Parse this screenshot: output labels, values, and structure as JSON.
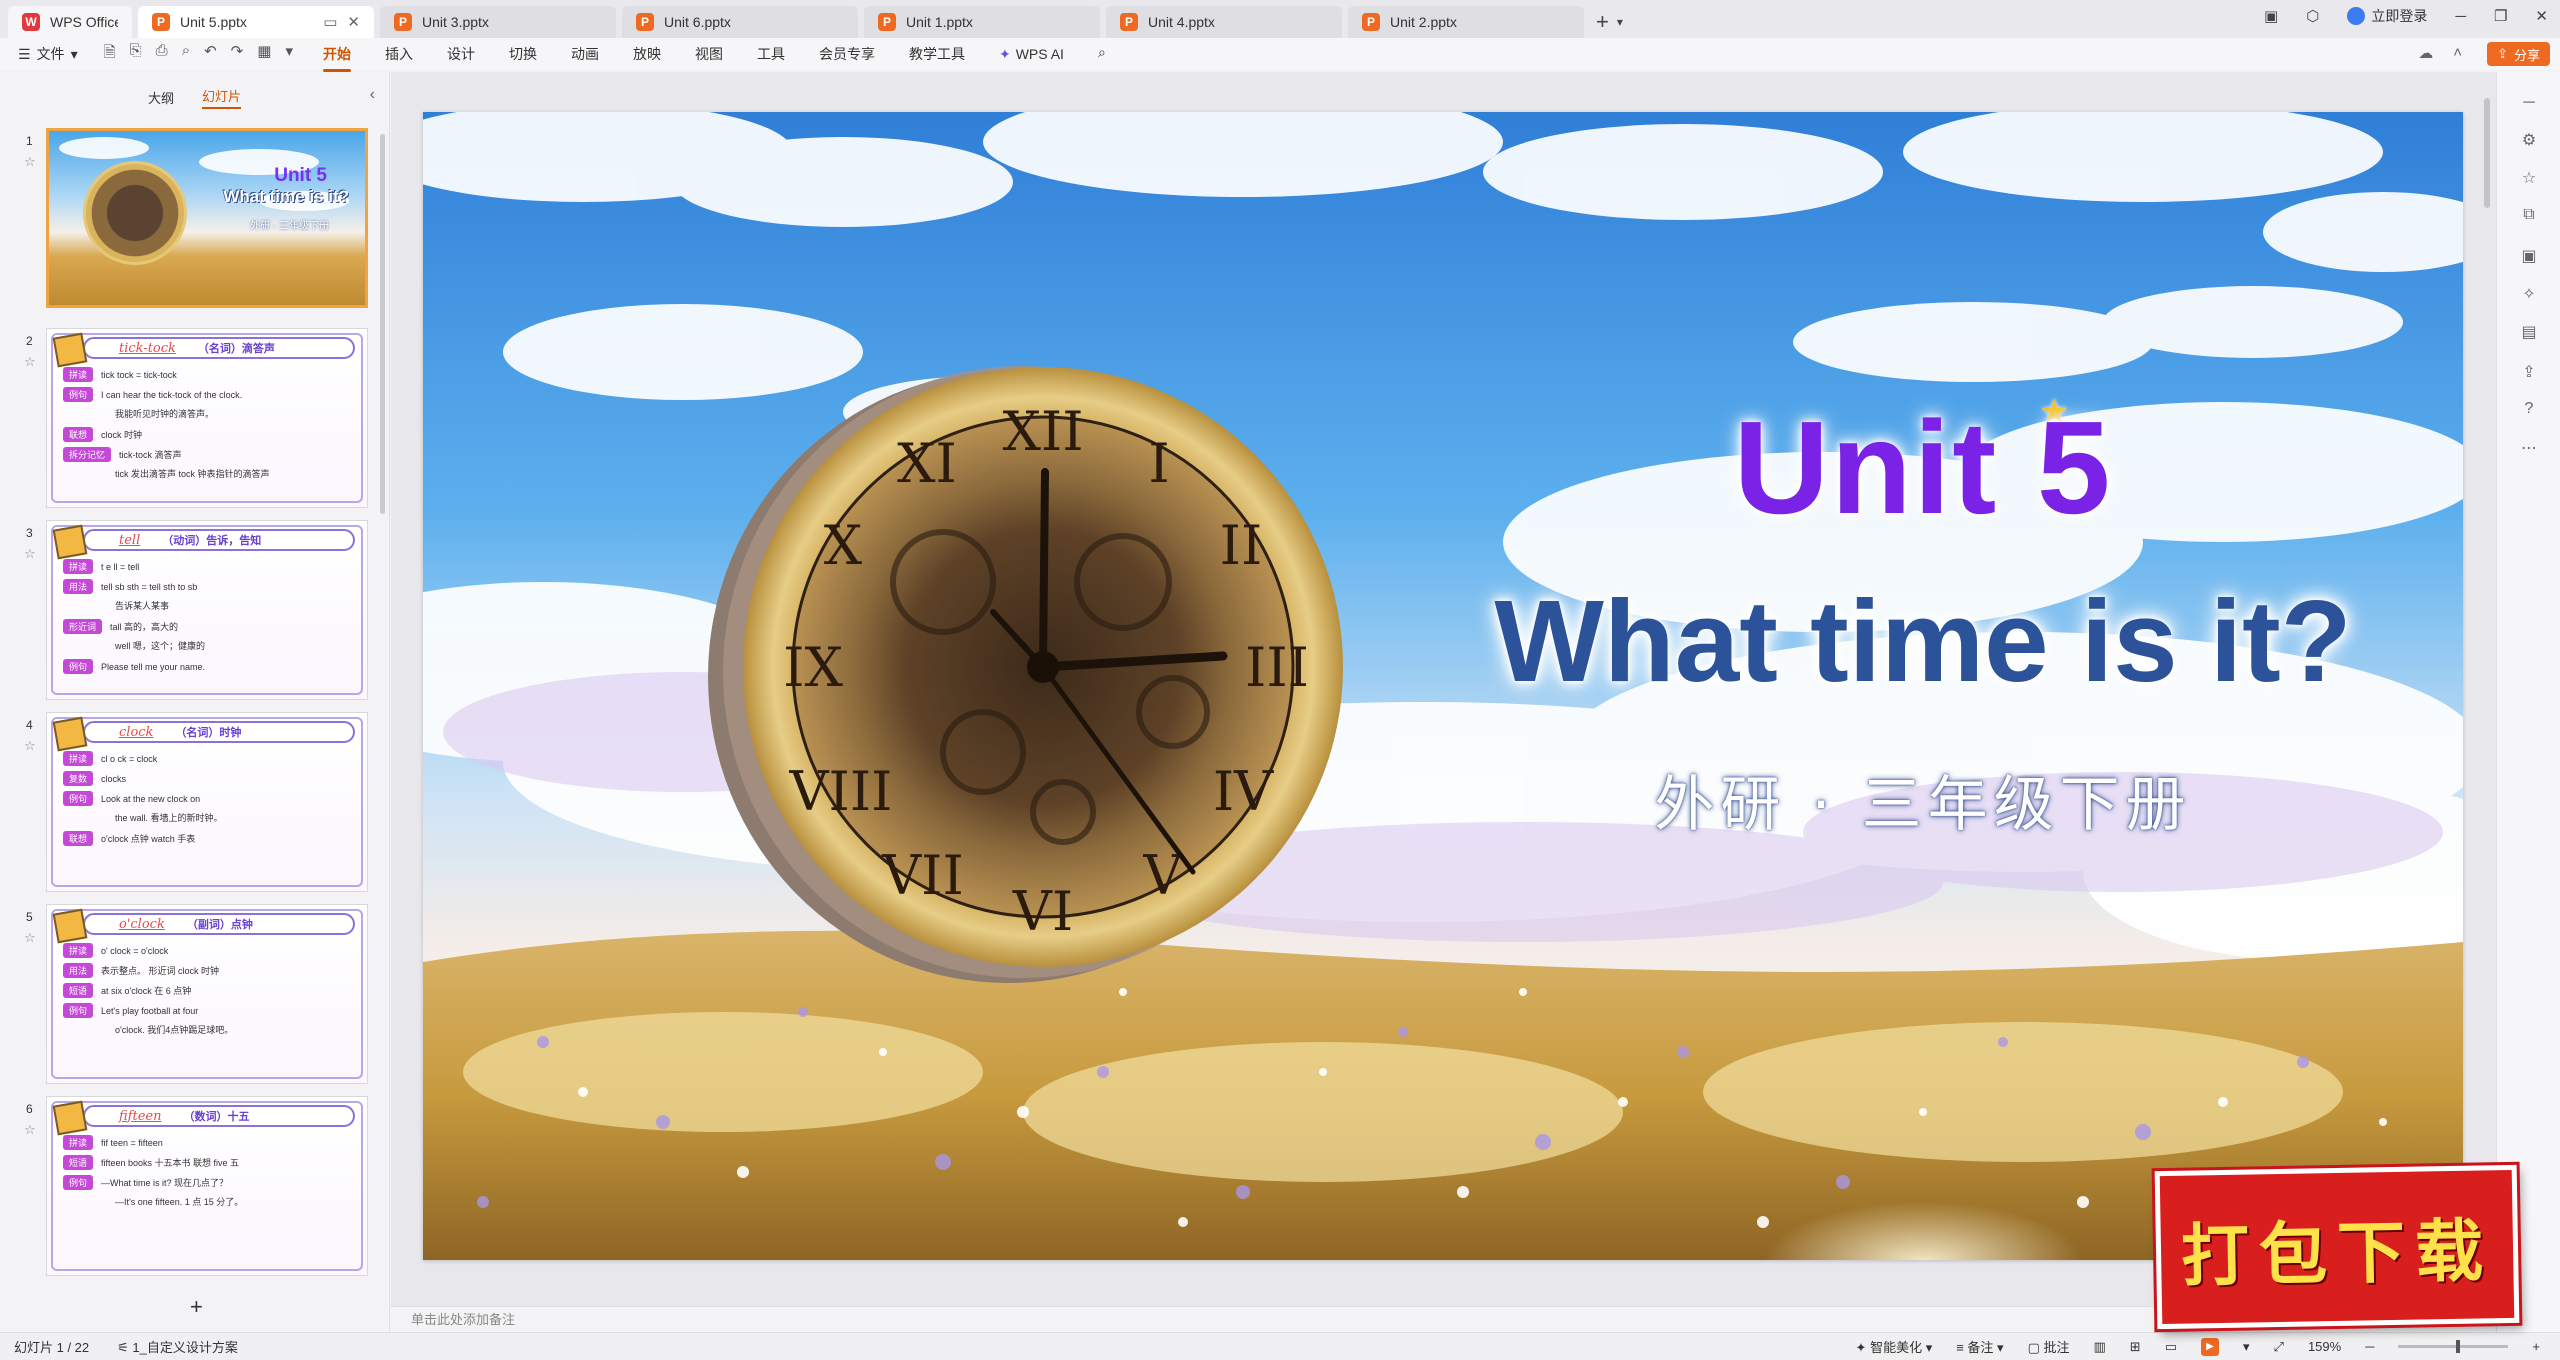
{
  "tabs": {
    "home_label": "WPS Office",
    "items": [
      {
        "label": "Unit 5.pptx",
        "active": true
      },
      {
        "label": "Unit 3.pptx"
      },
      {
        "label": "Unit 6.pptx"
      },
      {
        "label": "Unit 1.pptx"
      },
      {
        "label": "Unit 4.pptx"
      },
      {
        "label": "Unit 2.pptx"
      }
    ],
    "new_tab": "+",
    "login": "立即登录"
  },
  "ribbon": {
    "file_menu": "文件",
    "tabs": [
      "开始",
      "插入",
      "设计",
      "切换",
      "动画",
      "放映",
      "视图",
      "工具",
      "会员专享",
      "教学工具"
    ],
    "active_tab": "开始",
    "wps_ai": "WPS AI",
    "share": "分享"
  },
  "left_pane": {
    "tab_outline": "大纲",
    "tab_slides": "幻灯片",
    "add_slide": "+",
    "thumb1": {
      "unit": "Unit 5",
      "title": "What time is it?",
      "sub": "外研 · 三年级下册"
    },
    "vocab": [
      {
        "num": "2",
        "word": "tick-tock",
        "meaning": "（名词）滴答声",
        "lines": [
          {
            "tag": "拼读",
            "text": "tick  tock = tick-tock"
          },
          {
            "tag": "例句",
            "text": "I can hear the tick-tock of the clock."
          },
          {
            "tag": "",
            "text": "我能听见时钟的滴答声。"
          },
          {
            "tag": "联想",
            "text": "clock 时钟"
          },
          {
            "tag": "拆分记忆",
            "text": "tick-tock 滴答声"
          },
          {
            "tag": "",
            "text": "tick 发出滴答声    tock 钟表指针的滴答声"
          }
        ]
      },
      {
        "num": "3",
        "word": "tell",
        "meaning": "（动词）告诉，告知",
        "lines": [
          {
            "tag": "拼读",
            "text": "t  e  ll = tell"
          },
          {
            "tag": "用法",
            "text": "tell sb sth = tell sth to sb"
          },
          {
            "tag": "",
            "text": "告诉某人某事"
          },
          {
            "tag": "形近词",
            "text": "tall 高的，高大的"
          },
          {
            "tag": "",
            "text": "well 嗯，这个；健康的"
          },
          {
            "tag": "例句",
            "text": "Please tell me your name."
          }
        ]
      },
      {
        "num": "4",
        "word": "clock",
        "meaning": "（名词）时钟",
        "lines": [
          {
            "tag": "拼读",
            "text": "cl  o  ck = clock"
          },
          {
            "tag": "复数",
            "text": "clocks"
          },
          {
            "tag": "例句",
            "text": "Look at the new clock on"
          },
          {
            "tag": "",
            "text": "the wall. 看墙上的新时钟。"
          },
          {
            "tag": "联想",
            "text": "o'clock 点钟    watch 手表"
          }
        ]
      },
      {
        "num": "5",
        "word": "o'clock",
        "meaning": "（副词）点钟",
        "lines": [
          {
            "tag": "拼读",
            "text": "o'  clock = o'clock"
          },
          {
            "tag": "用法",
            "text": "表示整点。   形近词  clock 时钟"
          },
          {
            "tag": "短语",
            "text": "at six o'clock 在 6 点钟"
          },
          {
            "tag": "例句",
            "text": "Let's play football at four"
          },
          {
            "tag": "",
            "text": "o'clock. 我们4点钟踢足球吧。"
          }
        ]
      },
      {
        "num": "6",
        "word": "fifteen",
        "meaning": "（数词）十五",
        "lines": [
          {
            "tag": "拼读",
            "text": "fif  teen = fifteen"
          },
          {
            "tag": "短语",
            "text": "fifteen books 十五本书    联想  five 五"
          },
          {
            "tag": "例句",
            "text": "—What time is it? 现在几点了？"
          },
          {
            "tag": "",
            "text": "—It's one fifteen. 1 点 15 分了。"
          }
        ]
      }
    ]
  },
  "slide": {
    "title_unit": "Unit 5",
    "title_main": "What time is it?",
    "subtitle": "外研 · 三年级下册"
  },
  "notes_placeholder": "单击此处添加备注",
  "status": {
    "slide_counter": "幻灯片 1 / 22",
    "theme": "1_自定义设计方案",
    "beautify": "智能美化",
    "notes": "备注",
    "comments": "批注",
    "zoom": "159%",
    "zoom_level": 0.55
  },
  "banner": {
    "text": "打包下载"
  },
  "colors": {
    "accent": "#d35400",
    "unit_purple": "#7a22e6",
    "title_blue": "#2c5299",
    "banner_red": "#d91e1e"
  }
}
